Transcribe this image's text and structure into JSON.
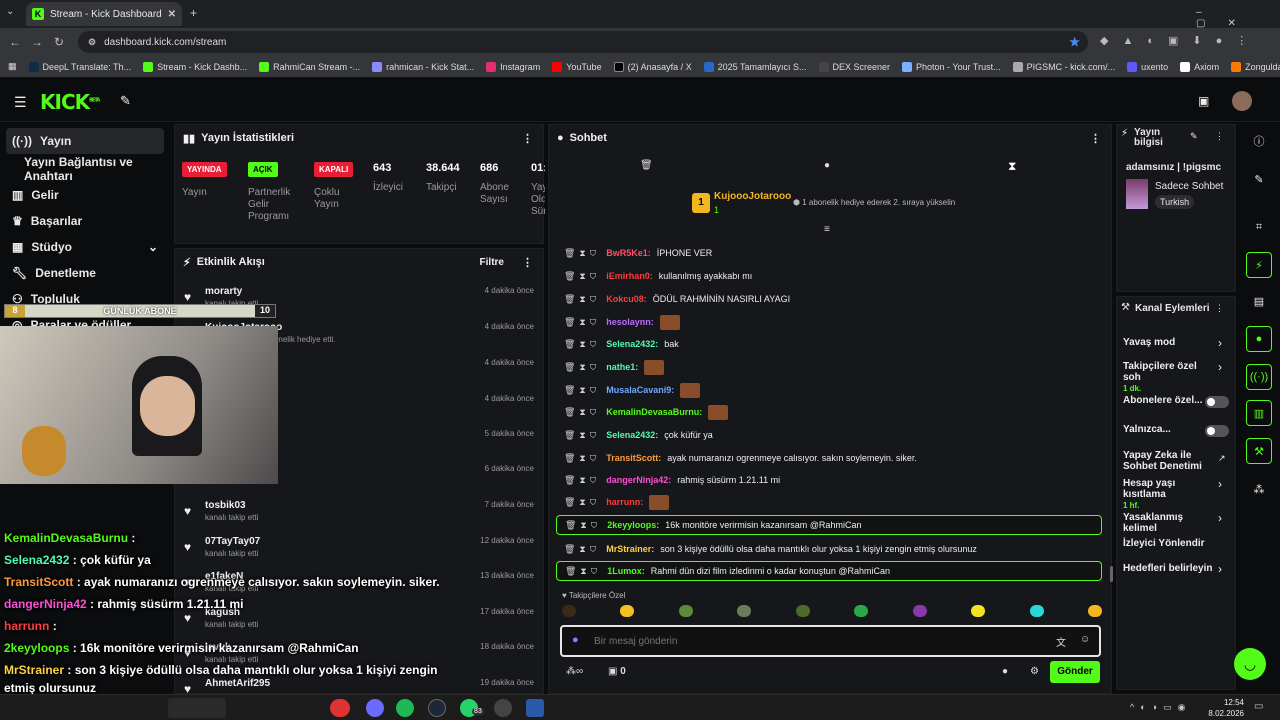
{
  "browser": {
    "tab_title": "Stream - Kick Dashboard",
    "url": "dashboard.kick.com/stream",
    "bookmarks": [
      "DeepL Translate: Th...",
      "Stream - Kick Dashb...",
      "RahmiCan Stream -...",
      "rahmican - Kick Stat...",
      "Instagram",
      "YouTube",
      "(2) Anasayfa / X",
      "2025 Tamamlayıcı S...",
      "DEX Screener",
      "Photon - Your Trust...",
      "PIGSMC - kick.com/...",
      "uxento",
      "Axiom",
      "Zonguldak İngilizce..."
    ]
  },
  "app": {
    "logo": "KICK",
    "logo_sup": "BETA"
  },
  "sidebar": {
    "items": [
      {
        "label": "Yayın",
        "icon": "broadcast-icon"
      },
      {
        "label": "Yayın Bağlantısı ve Anahtarı"
      },
      {
        "label": "Gelir",
        "icon": "bank-icon"
      },
      {
        "label": "Başarılar",
        "icon": "trophy-icon"
      },
      {
        "label": "Stüdyo",
        "icon": "grid-icon"
      },
      {
        "label": "Denetleme",
        "icon": "wrench-icon"
      },
      {
        "label": "Topluluk"
      },
      {
        "label": "Paralar ve ödüller"
      }
    ]
  },
  "stats": {
    "title": "Yayın İstatistikleri",
    "badges": [
      {
        "text": "YAYINDA",
        "label": "Yayın",
        "color": "#e91e36"
      },
      {
        "text": "AÇIK",
        "label": "Partnerlik Gelir Programı",
        "color": "#53fc18"
      },
      {
        "text": "KAPALI",
        "label": "Çoklu Yayın",
        "color": "#e91e36"
      }
    ],
    "numbers": [
      {
        "value": "643",
        "label": "İzleyici"
      },
      {
        "value": "38.644",
        "label": "Takipçi"
      },
      {
        "value": "686",
        "label": "Abone Sayısı"
      },
      {
        "value": "01:",
        "label": "Yay Old Sür"
      }
    ]
  },
  "activity": {
    "title": "Etkinlik Akışı",
    "filter": "Filtre",
    "items": [
      {
        "name": "morarty",
        "sub": "kanalı takip etti",
        "time": "4 dakika önce"
      },
      {
        "name": "KujoooJotarooo",
        "sub": "isimli kullanıcıya abonelik hediye etti.",
        "time": "4 dakika önce"
      },
      {
        "name": "",
        "sub": "",
        "time": "4 dakika önce"
      },
      {
        "name": "",
        "sub": "",
        "time": "4 dakika önce"
      },
      {
        "name": "",
        "sub": "",
        "time": "5 dakika önce"
      },
      {
        "name": "gilim",
        "sub": "",
        "time": "6 dakika önce"
      },
      {
        "name": "tosbik03",
        "sub": "kanalı takip etti",
        "time": "7 dakika önce"
      },
      {
        "name": "07TayTay07",
        "sub": "kanalı takip etti",
        "time": "12 dakika önce"
      },
      {
        "name": "e1fakeN",
        "sub": "kanalı takip etti",
        "time": "13 dakika önce"
      },
      {
        "name": "kagush",
        "sub": "kanalı takip etti",
        "time": "17 dakika önce"
      },
      {
        "name": "lavuk",
        "sub": "kanalı takip etti",
        "time": "18 dakika önce"
      },
      {
        "name": "AhmetArif295",
        "sub": "",
        "time": "19 dakika önce"
      }
    ]
  },
  "goal": {
    "left": "8",
    "label": "GÜNLÜK ABONE",
    "right": "10"
  },
  "chat": {
    "title": "Sohbet",
    "pinned": {
      "user": "KujoooJotarooo",
      "rank": "1",
      "count": "1",
      "text": "1 abonelik hediye ederek 2. sıraya yükselin"
    },
    "messages": [
      {
        "user": "BwR5Ke1",
        "color": "#ff4f6a",
        "text": "İPHONE VER",
        "hl": false
      },
      {
        "user": "iEmirhan0",
        "color": "#ff3b3b",
        "text": "kullanılmış ayakkabı mı",
        "hl": false
      },
      {
        "user": "Kokcu08",
        "color": "#ff3b3b",
        "text": "ÖDÜL RAHMİNİN NASIRLI AYAGI",
        "hl": false
      },
      {
        "user": "hesolaynn",
        "color": "#b86bff",
        "text": "",
        "emote": true,
        "hl": false
      },
      {
        "user": "Selena2432",
        "color": "#53fcb0",
        "text": "bak",
        "hl": false
      },
      {
        "user": "nathe1",
        "color": "#53fcb0",
        "text": "",
        "emote": true,
        "hl": false
      },
      {
        "user": "MusalaCavani9",
        "color": "#6fa8ff",
        "text": "",
        "emote": true,
        "hl": false
      },
      {
        "user": "KemalinDevasaBurnu",
        "color": "#53fc18",
        "text": "",
        "emote": true,
        "hl": false
      },
      {
        "user": "Selena2432",
        "color": "#53fcb0",
        "text": "çok küfür ya",
        "hl": false
      },
      {
        "user": "TransitScott",
        "color": "#ff9a3c",
        "text": "ayak numaranızı ogrenmeye calısıyor. sakın soylemeyin. siker.",
        "hl": false
      },
      {
        "user": "dangerNinja42",
        "color": "#ff4fd8",
        "text": "rahmiş süsürm 1.21.11 mi",
        "hl": false
      },
      {
        "user": "harrunn",
        "color": "#ff3b3b",
        "text": "",
        "emote": true,
        "hl": false
      },
      {
        "user": "2keyyloops",
        "color": "#53fc18",
        "text": "16k monitöre verirmisin kazanırsam @RahmiCan",
        "hl": true
      },
      {
        "user": "MrStrainer",
        "color": "#ffd23c",
        "text": "son 3 kişiye ödüllü olsa daha mantıklı olur yoksa 1 kişiyi zengin etmiş olursunuz",
        "hl": false
      },
      {
        "user": "1Lumox",
        "color": "#53fc18",
        "text": "Rahmi dün dizi film izledinmi o kadar konuştun @RahmiCan",
        "hl": true
      }
    ],
    "emote_section": "Takipçilere Özel",
    "input_placeholder": "Bir mesaj gönderin",
    "footer_count": "0",
    "send": "Gönder"
  },
  "stream_info": {
    "title": "Yayın bilgisi",
    "stream_title": "adamsınız | !pigsmc",
    "category": "Sadece Sohbet",
    "language": "Turkish"
  },
  "channel_actions": {
    "title": "Kanal Eylemleri",
    "items": [
      {
        "label": "Yavaş mod",
        "type": "chevron"
      },
      {
        "label": "Takipçilere özel soh",
        "sub": "1 dk.",
        "type": "chevron"
      },
      {
        "label": "Abonelere özel...",
        "type": "toggle"
      },
      {
        "label": "Yalnızca...",
        "type": "toggle"
      },
      {
        "label": "Yapay Zeka ile Sohbet Denetimi",
        "type": "link"
      },
      {
        "label": "Hesap yaşı kısıtlama",
        "sub": "1 hf.",
        "type": "chevron"
      },
      {
        "label": "Yasaklanmış kelimel",
        "type": "chevron"
      },
      {
        "label": "İzleyici Yönlendir",
        "type": "none"
      },
      {
        "label": "Hedefleri belirleyin",
        "type": "chevron"
      }
    ]
  },
  "overlay_chat": [
    {
      "user": "KemalinDevasaBurnu",
      "text": ":"
    },
    {
      "user": "Selena2432",
      "text": ": çok küfür ya"
    },
    {
      "user": "TransitScott",
      "text": ": ayak numaranızı ogrenmeye calısıyor. sakın soylemeyin. siker."
    },
    {
      "user": "dangerNinja42",
      "text": ": rahmiş süsürm 1.21.11 mi"
    },
    {
      "user": "harrunn",
      "text": ":"
    },
    {
      "user": "2keyyloops",
      "text": ": 16k monitöre verirmisin kazanırsam @RahmiCan"
    },
    {
      "user": "MrStrainer",
      "text": ": son 3 kişiye ödüllü olsa daha mantıklı olur yoksa 1 kişiyi zengin"
    },
    {
      "user": "",
      "text": "etmiş olursunuz"
    },
    {
      "user": "1Lumox",
      "text": ": Rahmi dün dizi film izledinmi o kadar konuştun @RahmiCan"
    }
  ],
  "taskbar": {
    "time": "12:54",
    "date": "8.02.2026",
    "whatsapp_badge": "83"
  }
}
